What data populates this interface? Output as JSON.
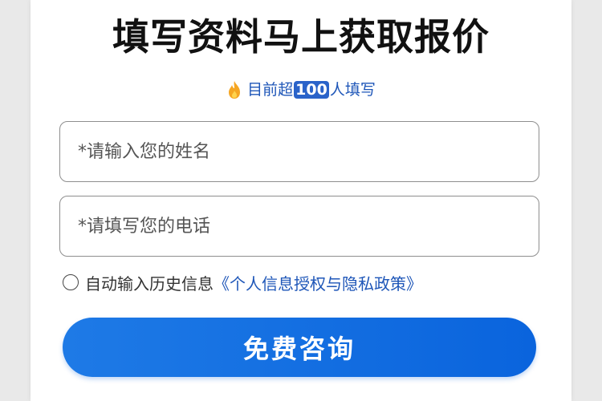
{
  "header": {
    "title": "填写资料马上获取报价",
    "subtitle_prefix": "目前超",
    "count": "100",
    "subtitle_suffix": "人填写",
    "fire_icon": "fire-icon",
    "accent_color": "#1e56b8"
  },
  "form": {
    "name_placeholder": "*请输入您的姓名",
    "name_value": "",
    "phone_placeholder": "*请填写您的电话",
    "phone_value": "",
    "consent_label": "自动输入历史信息",
    "policy_link": "《个人信息授权与隐私政策》",
    "consent_checked": false,
    "submit_label": "免费咨询",
    "button_color": "#0a64dd"
  }
}
